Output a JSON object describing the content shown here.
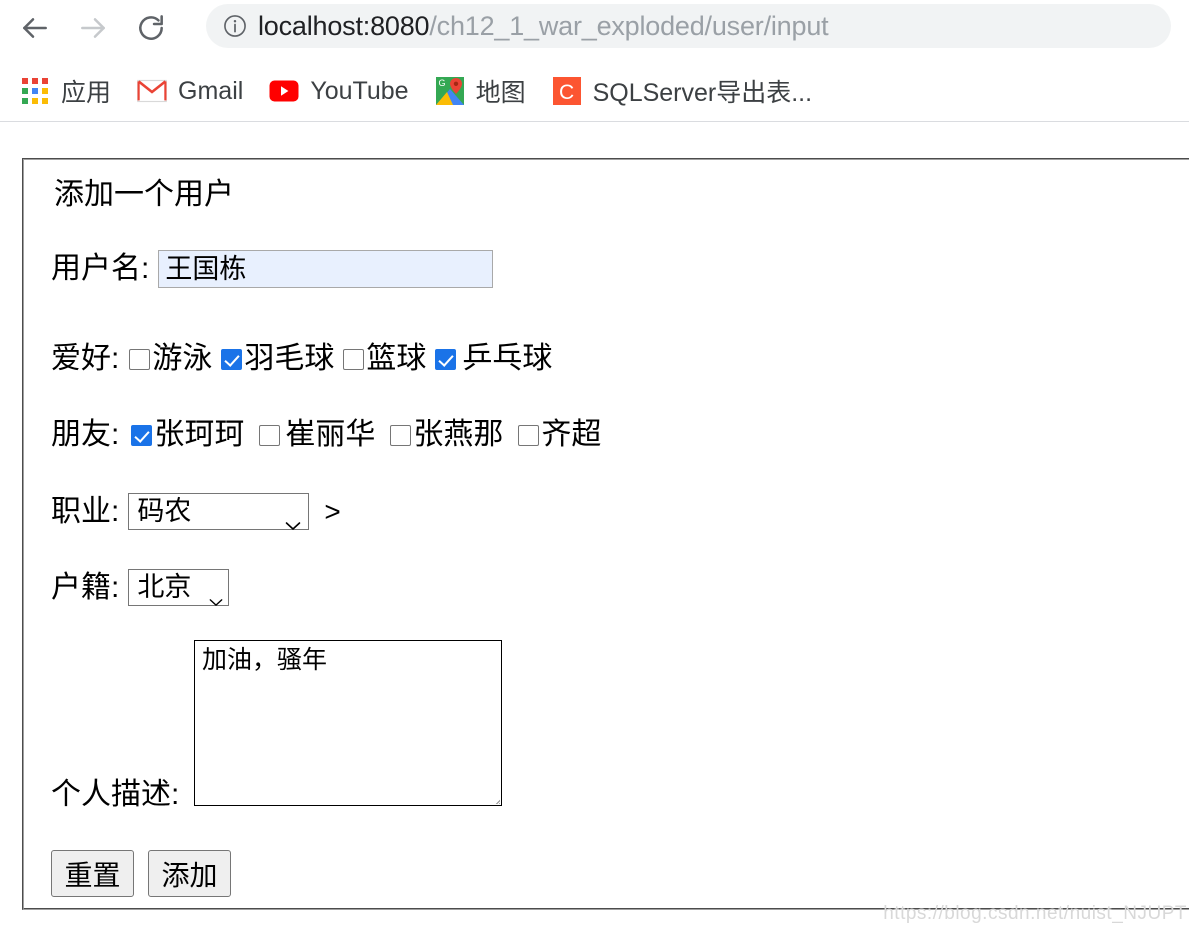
{
  "browser": {
    "nav": {
      "back_icon": "arrow-left-icon",
      "forward_icon": "arrow-right-icon",
      "reload_icon": "reload-icon"
    },
    "omnibox": {
      "site_info_icon": "info-circle-icon",
      "url_host": "localhost:8080",
      "url_path": "/ch12_1_war_exploded/user/input",
      "url_full": "localhost:8080/ch12_1_war_exploded/user/input"
    },
    "bookmarks": [
      {
        "icon": "apps-grid-icon",
        "label": "应用"
      },
      {
        "icon": "gmail-icon",
        "label": "Gmail"
      },
      {
        "icon": "youtube-icon",
        "label": "YouTube"
      },
      {
        "icon": "google-maps-icon",
        "label": "地图"
      },
      {
        "icon": "csdn-icon",
        "label": "SQLServer导出表..."
      }
    ]
  },
  "form": {
    "legend": "添加一个用户",
    "username": {
      "label": "用户名:",
      "value": "王国栋",
      "placeholder": ""
    },
    "hobby": {
      "label": "爱好:",
      "options": [
        {
          "label": "游泳",
          "checked": false
        },
        {
          "label": "羽毛球",
          "checked": true
        },
        {
          "label": "篮球",
          "checked": false
        },
        {
          "label": "乒乓球",
          "checked": true
        }
      ]
    },
    "friends": {
      "label": "朋友:",
      "options": [
        {
          "label": "张珂珂",
          "checked": true
        },
        {
          "label": "崔丽华",
          "checked": false
        },
        {
          "label": "张燕那",
          "checked": false
        },
        {
          "label": "齐超",
          "checked": false
        }
      ]
    },
    "job": {
      "label": "职业:",
      "value": "码农",
      "trailing_text": ">"
    },
    "hometown": {
      "label": "户籍:",
      "value": "北京"
    },
    "description": {
      "label": "个人描述:",
      "value": "加油，骚年"
    },
    "buttons": {
      "reset": "重置",
      "submit": "添加"
    }
  },
  "watermark": "https://blog.csdn.net/nuist_NJUPT",
  "colors": {
    "accent_checkbox": "#1a73e8",
    "autofill_input_bg": "#e8f0fe",
    "omnibox_bg": "#f1f3f4",
    "url_host_text": "#202124",
    "url_path_text": "#9aa0a6",
    "fieldset_border": "#a0a0a0",
    "button_bg": "#efefef"
  }
}
